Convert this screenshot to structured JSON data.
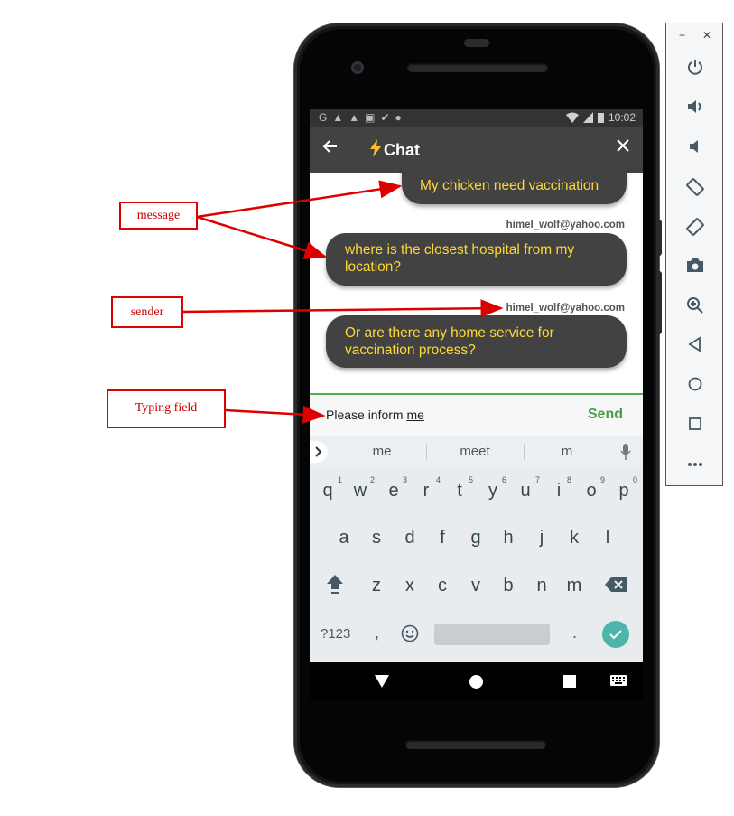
{
  "statusbar": {
    "icons": [
      "G",
      "▲",
      "▲",
      "▣",
      "✔",
      "●"
    ],
    "time": "10:02"
  },
  "appbar": {
    "back_icon": "arrow-left-icon",
    "bolt_icon": "lightning-icon",
    "title": "Chat",
    "close_icon": "close-icon"
  },
  "messages": [
    {
      "text": "My chicken need vaccination"
    },
    {
      "sender": "himel_wolf@yahoo.com",
      "text": "where is the closest hospital from my location?"
    },
    {
      "sender": "himel_wolf@yahoo.com",
      "text": "Or are there any home service for vaccination process?"
    }
  ],
  "input": {
    "value_prefix": "Please inform ",
    "value_underlined": "me",
    "send_label": "Send"
  },
  "keyboard": {
    "suggestions": [
      "me",
      "meet",
      "m"
    ],
    "row1": [
      "q",
      "w",
      "e",
      "r",
      "t",
      "y",
      "u",
      "i",
      "o",
      "p"
    ],
    "row1_numbers": [
      "1",
      "2",
      "3",
      "4",
      "5",
      "6",
      "7",
      "8",
      "9",
      "0"
    ],
    "row2": [
      "a",
      "s",
      "d",
      "f",
      "g",
      "h",
      "j",
      "k",
      "l"
    ],
    "row3": [
      "z",
      "x",
      "c",
      "v",
      "b",
      "n",
      "m"
    ],
    "symbols_label": "?123",
    "comma": ",",
    "period": "."
  },
  "annotations": {
    "message": "message",
    "sender": "sender",
    "typing_field": "Typing field"
  },
  "colors": {
    "appbar": "#424242",
    "bubble": "#424242",
    "bubble_text": "#fdd835",
    "accent_green": "#43a047",
    "annotation_red": "#dd0000"
  }
}
